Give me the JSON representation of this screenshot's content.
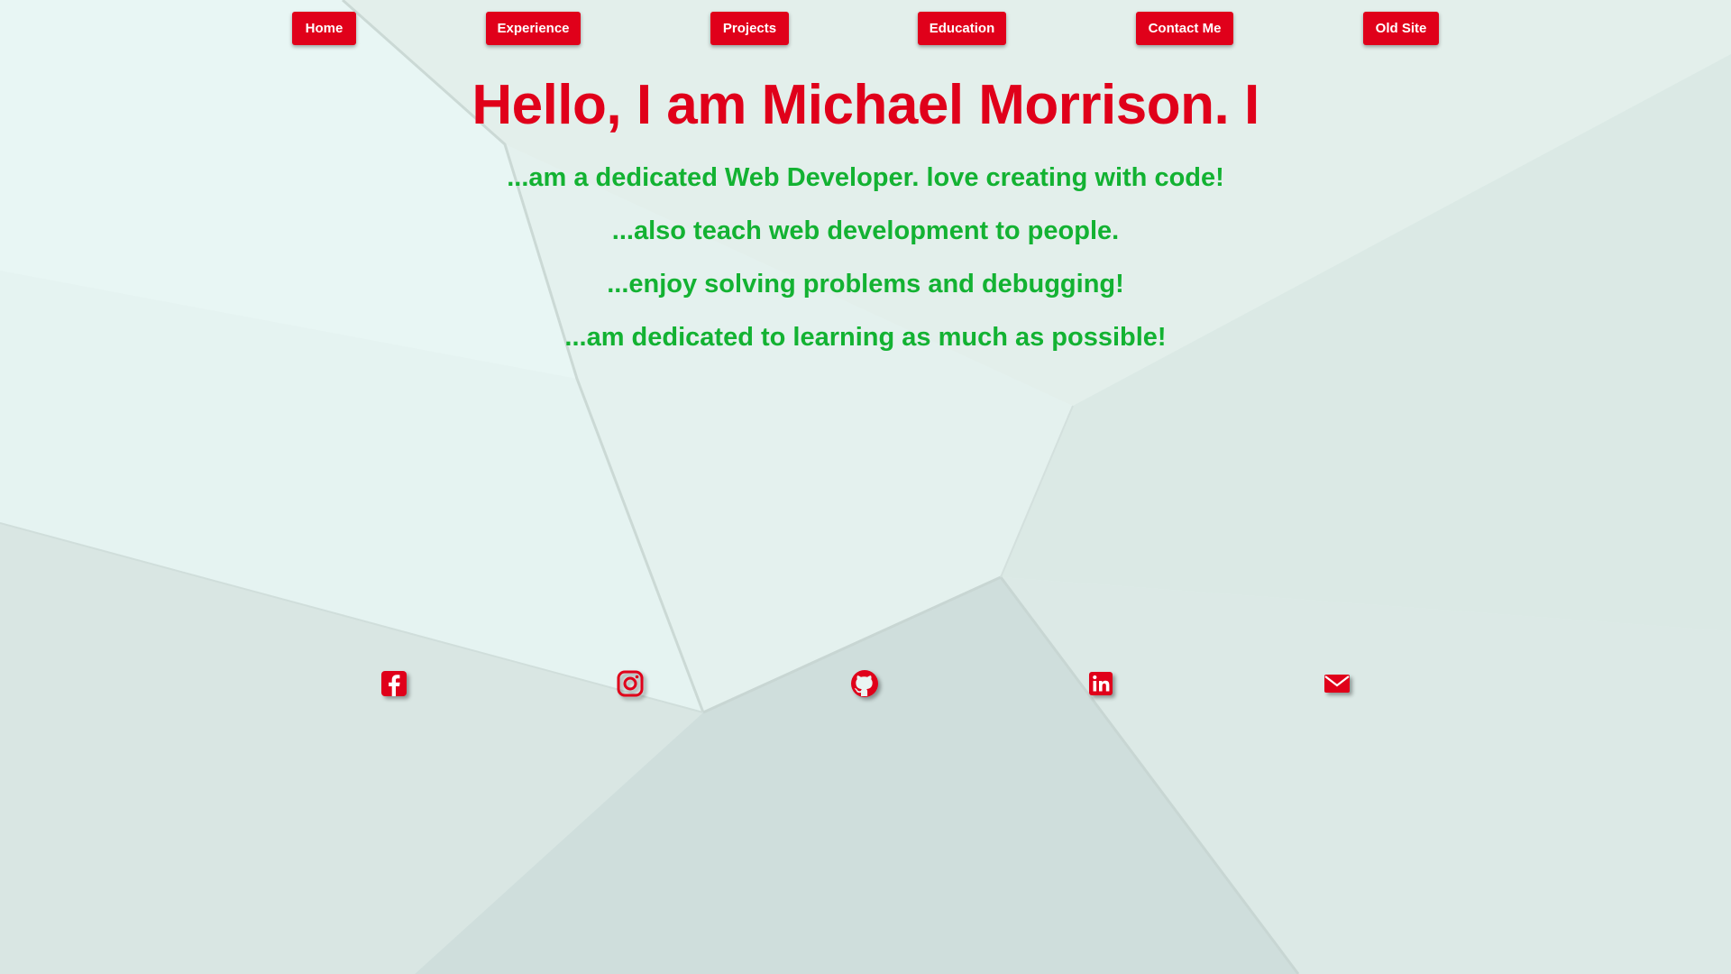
{
  "colors": {
    "accent": "#e0001a",
    "tagline": "#13b232",
    "button_text": "#ffffff",
    "background": "#e4f1ee"
  },
  "nav": {
    "items": [
      {
        "label": "Home"
      },
      {
        "label": "Experience"
      },
      {
        "label": "Projects"
      },
      {
        "label": "Education"
      },
      {
        "label": "Contact Me"
      },
      {
        "label": "Old Site"
      }
    ]
  },
  "hero": {
    "heading": "Hello, I am Michael Morrison. I",
    "taglines": [
      "...am a dedicated Web Developer. love creating with code!",
      "...also teach web development to people.",
      "...enjoy solving problems and debugging!",
      "...am dedicated to learning as much as possible!"
    ]
  },
  "social": {
    "icons": [
      "facebook-icon",
      "instagram-icon",
      "github-icon",
      "linkedin-icon",
      "mail-icon"
    ]
  }
}
